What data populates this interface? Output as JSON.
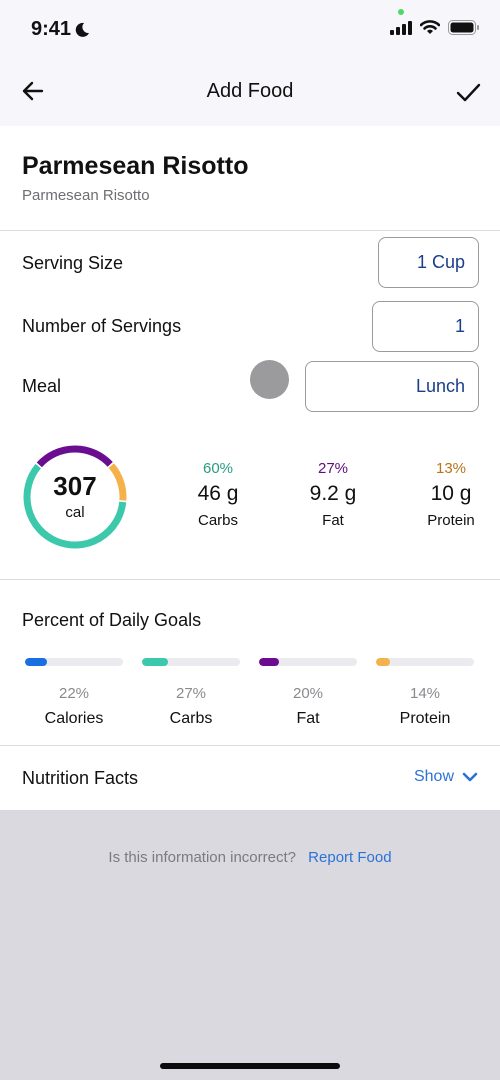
{
  "status_bar": {
    "time": "9:41",
    "icons": [
      "moon-icon",
      "signal-icon",
      "wifi-icon",
      "battery-icon"
    ]
  },
  "nav": {
    "title": "Add Food",
    "back_icon": "arrow-left-icon",
    "confirm_icon": "checkmark-icon"
  },
  "food": {
    "name": "Parmesean Risotto",
    "subtitle": "Parmesean Risotto"
  },
  "form": {
    "serving_size_label": "Serving Size",
    "serving_size_value": "1 Cup",
    "servings_label": "Number of Servings",
    "servings_value": "1",
    "meal_label": "Meal",
    "meal_value": "Lunch"
  },
  "summary": {
    "calories": "307",
    "calories_unit": "cal",
    "macros": [
      {
        "pct": "60%",
        "amount": "46 g",
        "name": "Carbs",
        "color": "#2a9d7f",
        "ring_color": "#3cc8aa",
        "fraction": 0.6
      },
      {
        "pct": "27%",
        "amount": "9.2 g",
        "name": "Fat",
        "color": "#5e0d7a",
        "ring_color": "#6a0d91",
        "fraction": 0.27
      },
      {
        "pct": "13%",
        "amount": "10 g",
        "name": "Protein",
        "color": "#b8751a",
        "ring_color": "#f5b14a",
        "fraction": 0.13
      }
    ]
  },
  "daily_goals": {
    "title": "Percent of Daily Goals",
    "items": [
      {
        "pct": "22%",
        "name": "Calories",
        "value": 22,
        "color": "#1a6fe0"
      },
      {
        "pct": "27%",
        "name": "Carbs",
        "value": 27,
        "color": "#3cc8aa"
      },
      {
        "pct": "20%",
        "name": "Fat",
        "value": 20,
        "color": "#6a0d91"
      },
      {
        "pct": "14%",
        "name": "Protein",
        "value": 14,
        "color": "#f5b14a"
      }
    ]
  },
  "nutrition_facts": {
    "label": "Nutrition Facts",
    "toggle_label": "Show",
    "toggle_icon": "chevron-down-icon"
  },
  "report": {
    "question": "Is this information incorrect?",
    "link": "Report Food"
  }
}
